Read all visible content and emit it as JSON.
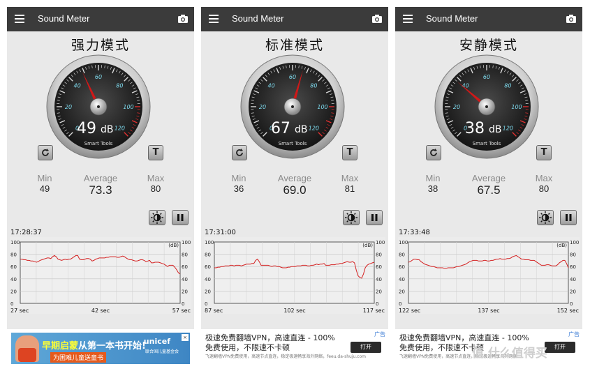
{
  "app": {
    "title": "Sound Meter",
    "gauge_brand": "Smart Tools",
    "unit": "dB",
    "graph_unit": "(dB)"
  },
  "gauge_ticks": [
    "0",
    "20",
    "40",
    "60",
    "80",
    "100",
    "120"
  ],
  "graph_y_ticks": [
    "100",
    "80",
    "60",
    "40",
    "20",
    "0"
  ],
  "panels": [
    {
      "mode": "强力模式",
      "db": "49",
      "needle_db": 49,
      "min_label": "Min",
      "avg_label": "Average",
      "max_label": "Max",
      "min": "49",
      "avg": "73.3",
      "max": "80",
      "time": "17:28:37",
      "x_labels": [
        "27 sec",
        "42 sec",
        "57 sec"
      ],
      "series": [
        72,
        72,
        71,
        71,
        70,
        70,
        69,
        69,
        68,
        67,
        68,
        70,
        71,
        72,
        73,
        74,
        74,
        73,
        76,
        78,
        76,
        72,
        71,
        70,
        71,
        72,
        71,
        72,
        72,
        74,
        76,
        78,
        78,
        72,
        71,
        71,
        72,
        73,
        73,
        72,
        69,
        70,
        72,
        73,
        74,
        74,
        74,
        74,
        75,
        75,
        76,
        76,
        76,
        76,
        75,
        75,
        76,
        77,
        76,
        74,
        72,
        71,
        71,
        70,
        69,
        69,
        70,
        71,
        71,
        70,
        68,
        69,
        70,
        66,
        66,
        67,
        67,
        67,
        66,
        65,
        64,
        62,
        60,
        62,
        62,
        62,
        59,
        55,
        50,
        48
      ]
    },
    {
      "mode": "标准模式",
      "db": "67",
      "needle_db": 67,
      "min_label": "Min",
      "avg_label": "Average",
      "max_label": "Max",
      "min": "36",
      "avg": "69.0",
      "max": "81",
      "time": "17:31:00",
      "x_labels": [
        "87 sec",
        "102 sec",
        "117 sec"
      ],
      "series": [
        58,
        58,
        59,
        59,
        60,
        60,
        61,
        61,
        61,
        62,
        62,
        61,
        62,
        62,
        62,
        61,
        62,
        63,
        64,
        64,
        64,
        65,
        65,
        70,
        72,
        68,
        62,
        62,
        62,
        62,
        62,
        61,
        60,
        61,
        61,
        60,
        60,
        59,
        58,
        58,
        58,
        59,
        59,
        60,
        60,
        60,
        61,
        61,
        61,
        62,
        62,
        62,
        61,
        61,
        62,
        62,
        63,
        64,
        63,
        64,
        64,
        65,
        62,
        62,
        62,
        63,
        63,
        63,
        64,
        64,
        65,
        65,
        66,
        67,
        68,
        67,
        67,
        68,
        66,
        54,
        45,
        42,
        41,
        48,
        58,
        62,
        64,
        65,
        66,
        67
      ]
    },
    {
      "mode": "安静模式",
      "db": "38",
      "needle_db": 38,
      "min_label": "Min",
      "avg_label": "Average",
      "max_label": "Max",
      "min": "38",
      "avg": "67.5",
      "max": "80",
      "time": "17:33:48",
      "x_labels": [
        "122 sec",
        "137 sec",
        "152 sec"
      ],
      "series": [
        67,
        68,
        70,
        72,
        72,
        71,
        71,
        68,
        66,
        64,
        63,
        62,
        61,
        60,
        60,
        59,
        58,
        58,
        58,
        58,
        57,
        57,
        58,
        58,
        58,
        58,
        59,
        60,
        60,
        61,
        62,
        63,
        64,
        66,
        68,
        69,
        70,
        70,
        70,
        69,
        69,
        69,
        70,
        70,
        69,
        69,
        70,
        70,
        71,
        72,
        72,
        73,
        72,
        72,
        72,
        73,
        73,
        74,
        76,
        77,
        78,
        76,
        74,
        72,
        72,
        71,
        71,
        71,
        70,
        70,
        70,
        68,
        66,
        64,
        62,
        62,
        62,
        63,
        63,
        62,
        61,
        61,
        61,
        63,
        66,
        68,
        70,
        70,
        65,
        58
      ]
    }
  ],
  "ads": [
    {
      "type": "banner",
      "headline_a": "早期启蒙",
      "headline_b": "从第一本书开始!",
      "brand": "unicef",
      "button": "为困难儿童送童书",
      "org": "联合国儿童基金会"
    },
    {
      "type": "text",
      "tag": "广告",
      "line1": "极速免费翻墙VPN，高速直连 - 100%",
      "line2": "免费使用，不限速不卡顿",
      "line3": "飞速翻墙VPN免费使用，高速节点直连，稳定极速畅享海外网络，feeu.da-shuju.com",
      "button": "打开"
    },
    {
      "type": "text",
      "tag": "广告",
      "line1": "极速免费翻墙VPN，高速直连 - 100%",
      "line2": "免费使用，不限速不卡顿",
      "line3": "飞速翻墙VPN免费使用，高速节点直连，稳定极速畅享海外网络",
      "button": "打开"
    }
  ],
  "watermark": "值 什么值得买",
  "colors": {
    "appbar": "#3b3b3b",
    "needle": "#d01818",
    "graph_line": "#d42020",
    "tick_cyan": "#7fdcf0"
  }
}
